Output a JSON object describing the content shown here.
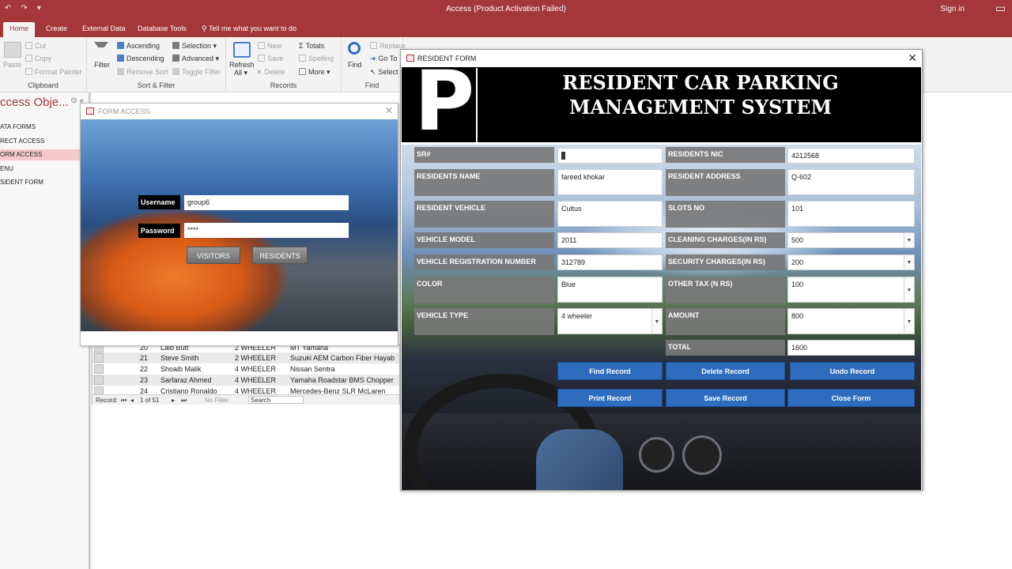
{
  "titlebar": {
    "title": "Access (Product Activation Failed)",
    "signin": "Sign in",
    "quick_access": [
      "↶",
      "↷",
      "▾"
    ],
    "window_controls": "▭"
  },
  "tabs": {
    "items": [
      "Home",
      "Create",
      "External Data",
      "Database Tools"
    ],
    "tell_me": "Tell me what you want to do"
  },
  "ribbon": {
    "clipboard": {
      "paste": "Paste",
      "cut": "Cut",
      "copy": "Copy",
      "format_painter": "Format Painter",
      "label": "Clipboard"
    },
    "sort_filter": {
      "filter": "Filter",
      "ascending": "Ascending",
      "descending": "Descending",
      "remove_sort": "Remove Sort",
      "selection": "Selection ▾",
      "advanced": "Advanced ▾",
      "toggle_filter": "Toggle Filter",
      "label": "Sort & Filter"
    },
    "records": {
      "refresh": "Refresh",
      "refresh_all": "All ▾",
      "new": "New",
      "save": "Save",
      "delete": "Delete",
      "totals": "Totals",
      "spelling": "Spelling",
      "more": "More ▾",
      "label": "Records"
    },
    "find": {
      "find": "Find",
      "replace": "Replace",
      "goto": "Go To",
      "select": "Select",
      "label": "Find"
    }
  },
  "navpane": {
    "header": "ccess Obje...",
    "header_ctl": "⊙ «",
    "items": [
      "ATA FORMS",
      "RECT ACCESS",
      "ORM ACCESS",
      "ENU",
      "SIDENT FORM"
    ],
    "selected_index": 2
  },
  "datasheet": {
    "rows": [
      {
        "id": "20",
        "name": "Laib Butt",
        "type": "2 WHEELER",
        "model": "MT Yamaha"
      },
      {
        "id": "21",
        "name": "Steve Smith",
        "type": "2 WHEELER",
        "model": "Suzuki AEM Carbon Fiber Hayab"
      },
      {
        "id": "22",
        "name": "Shoaib Malik",
        "type": "4 WHEELER",
        "model": "Nissan Sentra"
      },
      {
        "id": "23",
        "name": "Sarfaraz Ahmed",
        "type": "4 WHEELER",
        "model": "Yamaha Roadstar BMS Chopper"
      },
      {
        "id": "24",
        "name": "Cristiano Ronaldo",
        "type": "4 WHEELER",
        "model": "Mercedes-Benz SLR McLaren"
      }
    ],
    "navbar": {
      "record_label": "Record:",
      "first": "⏮",
      "prev": "◂",
      "position": "1 of 51",
      "next": "▸",
      "last": "⏭",
      "filter": "No Filter",
      "search": "Search"
    }
  },
  "form_access": {
    "title": "FORM ACCESS",
    "username_label": "Username",
    "username_value": "group6",
    "password_label": "Password",
    "password_value": "****",
    "visitors_button": "VISITORS",
    "residents_button": "RESIDENTS"
  },
  "resident_form": {
    "title": "RESIDENT FORM",
    "logo_letter": "P",
    "heading": "RESIDENT CAR PARKING  MANAGEMENT SYSTEM",
    "fields": {
      "sr_label": "SR#",
      "sr_value": "",
      "nic_label": "RESIDENTS NIC",
      "nic_value": "4212568",
      "name_label": "RESIDENTS NAME",
      "name_value": "fareed khokar",
      "address_label": "RESIDENT ADDRESS",
      "address_value": "Q-602",
      "vehicle_label": "RESIDENT VEHICLE",
      "vehicle_value": "Cultus",
      "slots_label": "SLOTS NO",
      "slots_value": "101",
      "model_label": "VEHICLE MODEL",
      "model_value": "2011",
      "cleaning_label": "CLEANING CHARGES(IN RS)",
      "cleaning_value": "500",
      "reg_label": "VEHICLE REGISTRATION NUMBER",
      "reg_value": "312789",
      "security_label": "SECURITY CHARGES(IN RS)",
      "security_value": "200",
      "color_label": "COLOR",
      "color_value": "Blue",
      "othertax_label": "OTHER TAX (N RS)",
      "othertax_value": "100",
      "type_label": "VEHICLE TYPE",
      "type_value": "4 wheeler",
      "amount_label": "AMOUNT",
      "amount_value": "800",
      "total_label": "TOTAL",
      "total_value": "1600"
    },
    "buttons": {
      "find": "Find Record",
      "delete": "Delete Record",
      "undo": "Undo Record",
      "print": "Print Record",
      "save": "Save Record",
      "close": "Close Form"
    }
  },
  "colors": {
    "accent": "#a4373a",
    "form_button": "#2e6dbd",
    "label_bg": "#787878",
    "header_bg": "#000000"
  }
}
